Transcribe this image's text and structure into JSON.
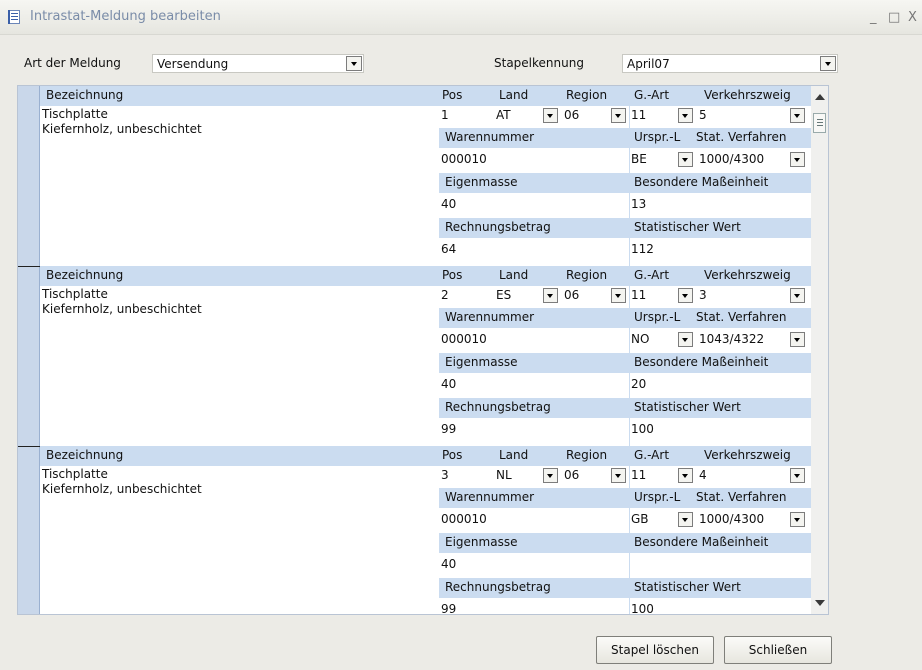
{
  "window": {
    "title": "Intrastat-Meldung bearbeiten",
    "minimize": "_",
    "maximize": "□",
    "close": "X"
  },
  "header": {
    "art_label": "Art der Meldung",
    "art_value": "Versendung",
    "stapel_label": "Stapelkennung",
    "stapel_value": "April07"
  },
  "columns": {
    "bezeichnung": "Bezeichnung",
    "pos": "Pos",
    "land": "Land",
    "region": "Region",
    "gart": "G.-Art",
    "verkehrszweig": "Verkehrszweig",
    "warennummer": "Warennummer",
    "ursprl": "Urspr.-L",
    "stat_verfahren": "Stat. Verfahren",
    "eigenmasse": "Eigenmasse",
    "besondere_masseinheit": "Besondere Maßeinheit",
    "rechnungsbetrag": "Rechnungsbetrag",
    "statistischer_wert": "Statistischer Wert"
  },
  "rows": [
    {
      "desc1": "Tischplatte",
      "desc2": "Kiefernholz, unbeschichtet",
      "pos": "1",
      "land": "AT",
      "region": "06",
      "gart": "11",
      "verkehrszweig": "5",
      "warennummer": "000010",
      "ursprl": "BE",
      "stat_verfahren": "1000/4300",
      "eigenmasse": "40",
      "besondere_masseinheit": "13",
      "rechnungsbetrag": "64",
      "statistischer_wert": "112"
    },
    {
      "desc1": "Tischplatte",
      "desc2": "Kiefernholz, unbeschichtet",
      "pos": "2",
      "land": "ES",
      "region": "06",
      "gart": "11",
      "verkehrszweig": "3",
      "warennummer": "000010",
      "ursprl": "NO",
      "stat_verfahren": "1043/4322",
      "eigenmasse": "40",
      "besondere_masseinheit": "20",
      "rechnungsbetrag": "99",
      "statistischer_wert": "100"
    },
    {
      "desc1": "Tischplatte",
      "desc2": "Kiefernholz, unbeschichtet",
      "pos": "3",
      "land": "NL",
      "region": "06",
      "gart": "11",
      "verkehrszweig": "4",
      "warennummer": "000010",
      "ursprl": "GB",
      "stat_verfahren": "1000/4300",
      "eigenmasse": "40",
      "besondere_masseinheit": "",
      "rechnungsbetrag": "99",
      "statistischer_wert": "100"
    }
  ],
  "buttons": {
    "stapel_loeschen": "Stapel löschen",
    "schliessen": "Schließen"
  }
}
